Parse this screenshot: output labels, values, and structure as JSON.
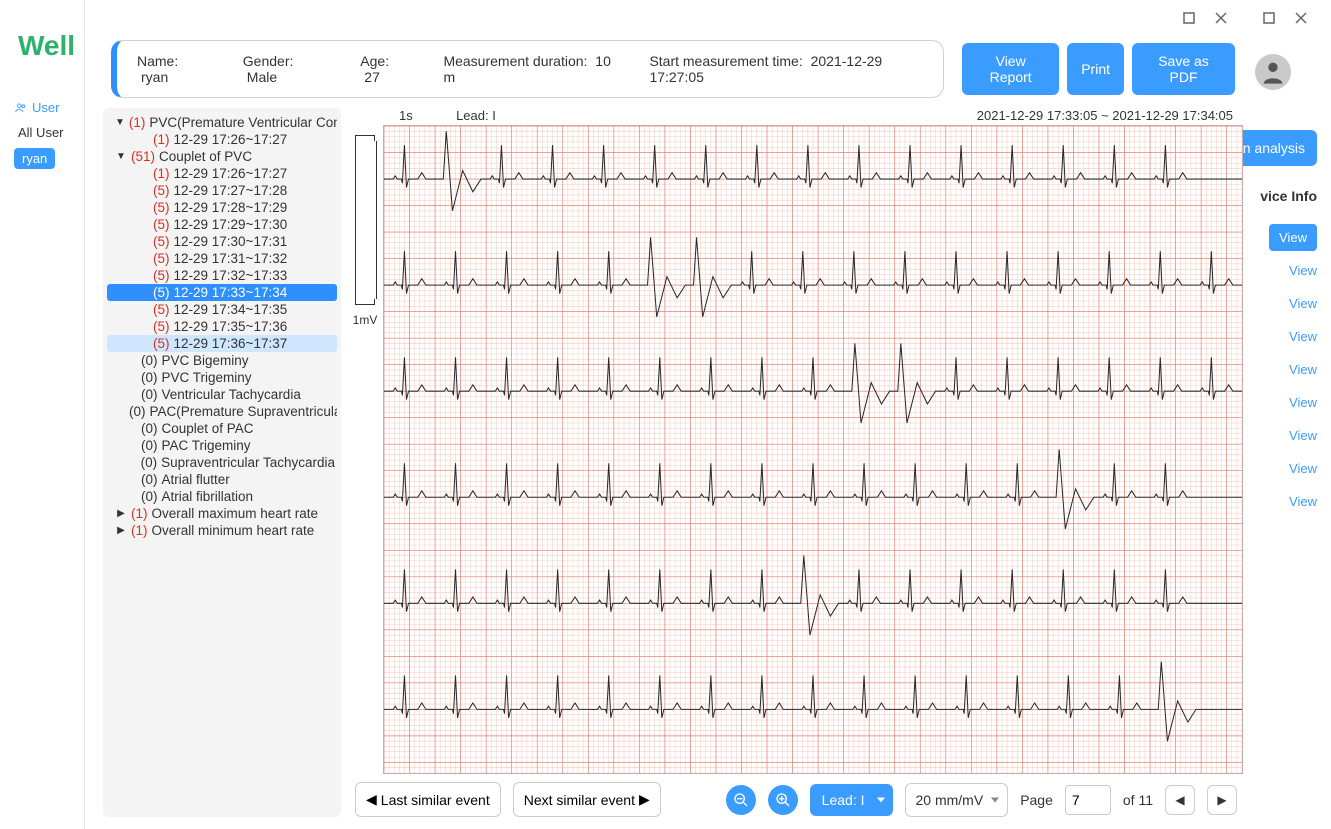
{
  "brand": "Well",
  "window": {
    "analysis_fragment": "n analysis",
    "device_info_fragment": "vice Info"
  },
  "avatar": {},
  "user_panel": {
    "header": "User",
    "all": "All User",
    "selected": "ryan"
  },
  "patient": {
    "name_label": "Name:",
    "name": "ryan",
    "gender_label": "Gender:",
    "gender": "Male",
    "age_label": "Age:",
    "age": "27",
    "duration_label": "Measurement duration:",
    "duration": "10 m",
    "start_label": "Start measurement time:",
    "start": "2021-12-29 17:27:05"
  },
  "buttons": {
    "view_report": "View Report",
    "print": "Print",
    "save_pdf": "Save as PDF"
  },
  "tree": {
    "pvc": {
      "count": "(1)",
      "label": "PVC(Premature Ventricular Contr...",
      "child": {
        "count": "(1)",
        "label": "12-29 17:26~17:27"
      }
    },
    "couplet": {
      "count": "(51)",
      "label": "Couplet of PVC",
      "children": [
        {
          "count": "(1)",
          "label": "12-29 17:26~17:27"
        },
        {
          "count": "(5)",
          "label": "12-29 17:27~17:28"
        },
        {
          "count": "(5)",
          "label": "12-29 17:28~17:29"
        },
        {
          "count": "(5)",
          "label": "12-29 17:29~17:30"
        },
        {
          "count": "(5)",
          "label": "12-29 17:30~17:31"
        },
        {
          "count": "(5)",
          "label": "12-29 17:31~17:32"
        },
        {
          "count": "(5)",
          "label": "12-29 17:32~17:33"
        },
        {
          "count": "(5)",
          "label": "12-29 17:33~17:34",
          "selected": true
        },
        {
          "count": "(5)",
          "label": "12-29 17:34~17:35"
        },
        {
          "count": "(5)",
          "label": "12-29 17:35~17:36"
        },
        {
          "count": "(5)",
          "label": "12-29 17:36~17:37",
          "hover": true
        }
      ]
    },
    "zeros": [
      {
        "count": "(0)",
        "label": "PVC Bigeminy"
      },
      {
        "count": "(0)",
        "label": "PVC Trigeminy"
      },
      {
        "count": "(0)",
        "label": "Ventricular Tachycardia"
      },
      {
        "count": "(0)",
        "label": "PAC(Premature Supraventricular ..."
      },
      {
        "count": "(0)",
        "label": "Couplet of PAC"
      },
      {
        "count": "(0)",
        "label": "PAC Trigeminy"
      },
      {
        "count": "(0)",
        "label": "Supraventricular Tachycardia"
      },
      {
        "count": "(0)",
        "label": "Atrial flutter"
      },
      {
        "count": "(0)",
        "label": "Atrial fibrillation"
      }
    ],
    "hrmax": {
      "count": "(1)",
      "label": "Overall maximum heart rate"
    },
    "hrmin": {
      "count": "(1)",
      "label": "Overall minimum heart rate"
    }
  },
  "ecg": {
    "time_scale": "1s",
    "lead_label": "Lead: I",
    "amplitude_label": "1mV",
    "timestamp": "2021-12-29 17:33:05 ~ 2021-12-29 17:34:05"
  },
  "footer": {
    "last_event": "Last similar event",
    "next_event": "Next similar event",
    "lead_sel": "Lead: I",
    "gain_sel": "20 mm/mV",
    "page_label": "Page",
    "page_value": "7",
    "page_total": "of 11"
  },
  "right_views": {
    "first_btn": "View",
    "links": [
      "View",
      "View",
      "View",
      "View",
      "View",
      "View",
      "View",
      "View"
    ]
  }
}
